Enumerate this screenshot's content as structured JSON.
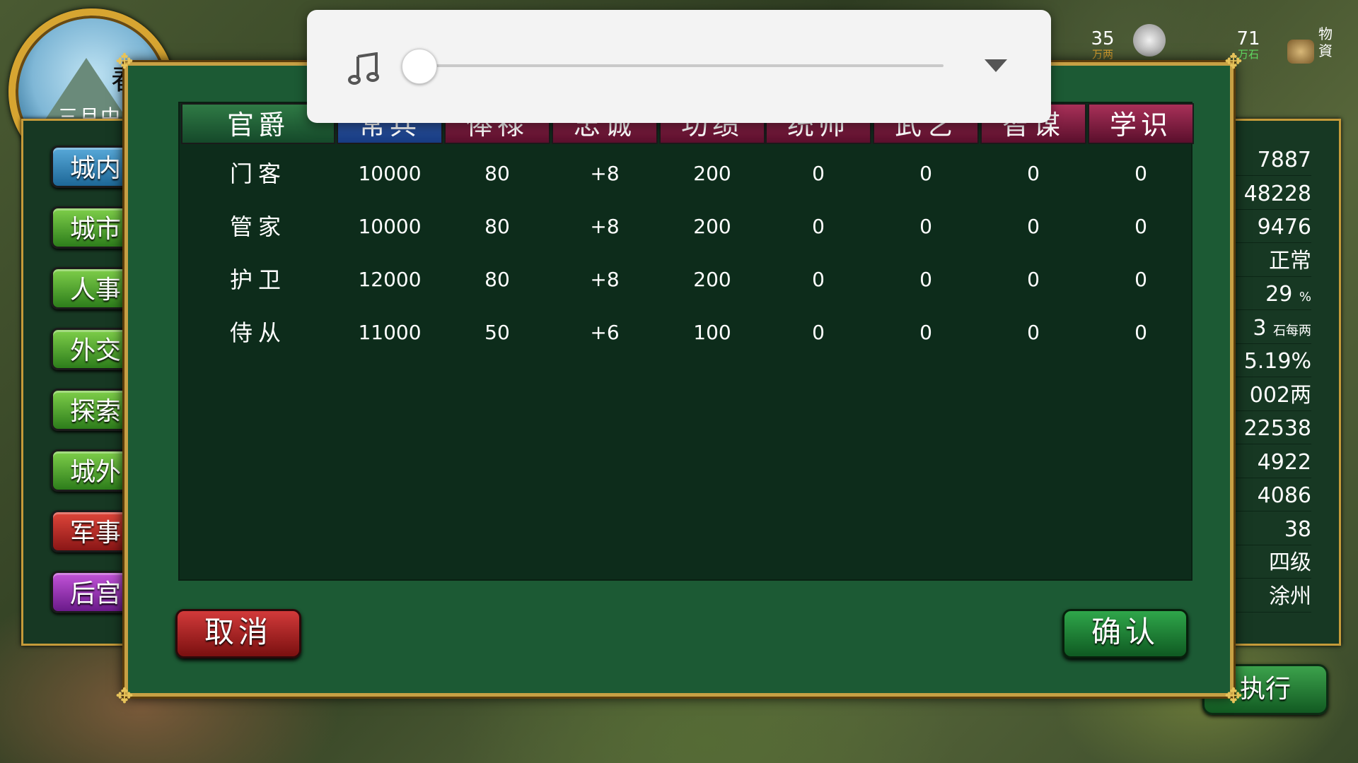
{
  "season": {
    "char": "春",
    "date": "三月中"
  },
  "top_resources": [
    {
      "value": "35",
      "unit": "万两"
    },
    {
      "value": "71",
      "unit": "万石"
    }
  ],
  "top_right_label": "物資",
  "sidebar": {
    "items": [
      {
        "label": "城内",
        "color": "blue"
      },
      {
        "label": "城市",
        "color": "green"
      },
      {
        "label": "人事",
        "color": "green"
      },
      {
        "label": "外交",
        "color": "green"
      },
      {
        "label": "探索",
        "color": "green"
      },
      {
        "label": "城外",
        "color": "green"
      },
      {
        "label": "军事",
        "color": "red"
      },
      {
        "label": "后宫",
        "color": "purple"
      }
    ]
  },
  "right_stats": {
    "values": [
      "7887",
      "48228",
      "9476",
      "正常",
      "29",
      "3",
      "5.19%",
      "002两",
      "22538",
      "4922",
      "4086",
      "38",
      "四级",
      "涂州"
    ],
    "percent_unit": "%",
    "rate_unit": "石每两"
  },
  "execute_label": "执行",
  "music": {
    "icon": "music-note-icon",
    "volume": 0
  },
  "table": {
    "headers": [
      {
        "label": "官爵",
        "color": "green"
      },
      {
        "label": "常兵",
        "color": "blue"
      },
      {
        "label": "俸禄",
        "color": "red"
      },
      {
        "label": "忠诚",
        "color": "red"
      },
      {
        "label": "功绩",
        "color": "red"
      },
      {
        "label": "统帅",
        "color": "red"
      },
      {
        "label": "武艺",
        "color": "red"
      },
      {
        "label": "智谋",
        "color": "red"
      },
      {
        "label": "学识",
        "color": "red"
      }
    ],
    "rows": [
      [
        "门客",
        "10000",
        "80",
        "+8",
        "200",
        "0",
        "0",
        "0",
        "0"
      ],
      [
        "管家",
        "10000",
        "80",
        "+8",
        "200",
        "0",
        "0",
        "0",
        "0"
      ],
      [
        "护卫",
        "12000",
        "80",
        "+8",
        "200",
        "0",
        "0",
        "0",
        "0"
      ],
      [
        "侍从",
        "11000",
        "50",
        "+6",
        "100",
        "0",
        "0",
        "0",
        "0"
      ]
    ]
  },
  "dialog": {
    "cancel_label": "取消",
    "confirm_label": "确认"
  },
  "colors": {
    "dialog_bg": "#1c5a34",
    "frame_gold": "#c7a044",
    "table_bg": "#0d2c1b"
  }
}
